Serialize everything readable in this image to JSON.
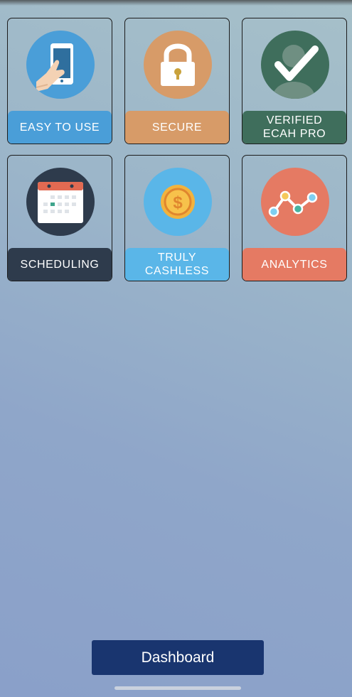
{
  "tiles": [
    {
      "label": "EASY TO USE",
      "icon": "touch-phone-icon",
      "color": "#4a9ed8"
    },
    {
      "label": "SECURE",
      "icon": "padlock-icon",
      "color": "#d79b68"
    },
    {
      "label": "VERIFIED\nECAH PRO",
      "icon": "verified-user-icon",
      "color": "#3f6e5c"
    },
    {
      "label": "SCHEDULING",
      "icon": "calendar-icon",
      "color": "#2e3b4c"
    },
    {
      "label": "TRULY CASHLESS",
      "icon": "dollar-coin-icon",
      "color": "#5ab6e8"
    },
    {
      "label": "ANALYTICS",
      "icon": "line-chart-icon",
      "color": "#e57a63"
    }
  ],
  "footer": {
    "dashboard_label": "Dashboard"
  }
}
